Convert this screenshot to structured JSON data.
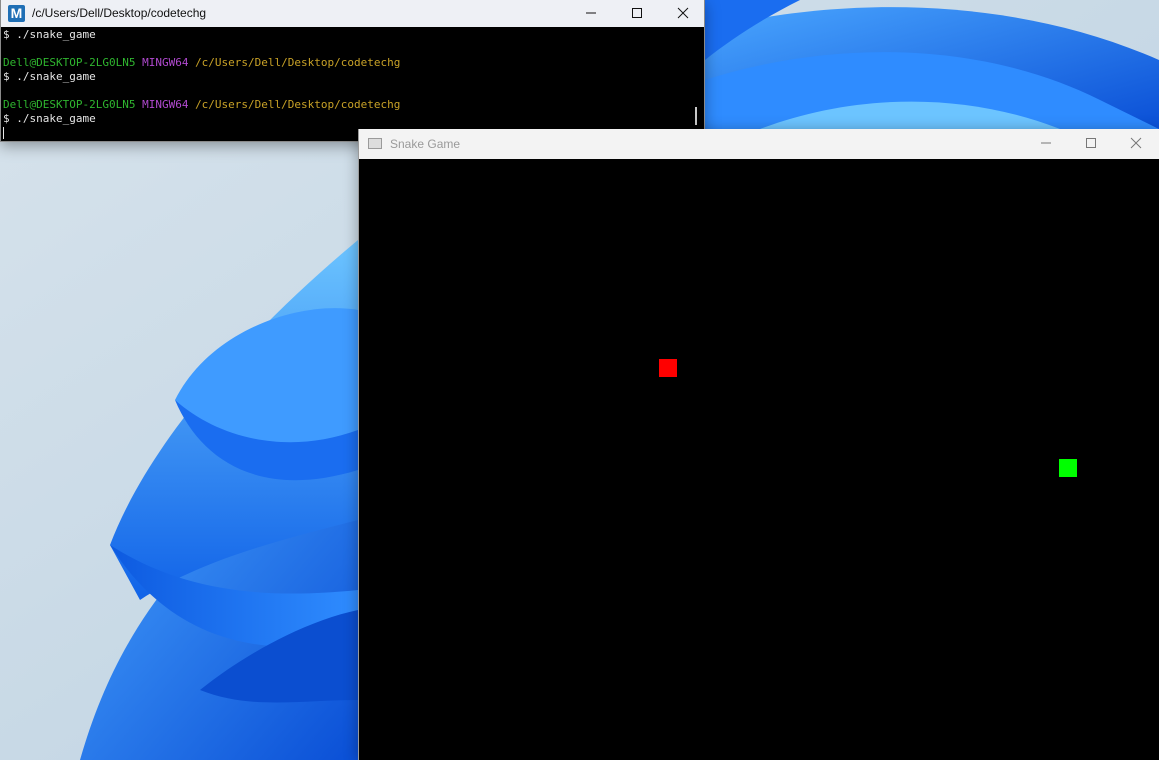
{
  "terminal": {
    "title": "/c/Users/Dell/Desktop/codetechg",
    "app_icon_letter": "M",
    "lines": [
      {
        "parts": [
          {
            "text": "$ ./snake_game",
            "color": "default"
          }
        ]
      },
      {
        "parts": []
      },
      {
        "parts": [
          {
            "text": "Dell@DESKTOP-2LG0LN5",
            "color": "user"
          },
          {
            "text": " ",
            "color": "default"
          },
          {
            "text": "MINGW64",
            "color": "sys"
          },
          {
            "text": " ",
            "color": "default"
          },
          {
            "text": "/c/Users/Dell/Desktop/codetechg",
            "color": "path"
          }
        ]
      },
      {
        "parts": [
          {
            "text": "$ ./snake_game",
            "color": "default"
          }
        ]
      },
      {
        "parts": []
      },
      {
        "parts": [
          {
            "text": "Dell@DESKTOP-2LG0LN5",
            "color": "user"
          },
          {
            "text": " ",
            "color": "default"
          },
          {
            "text": "MINGW64",
            "color": "sys"
          },
          {
            "text": " ",
            "color": "default"
          },
          {
            "text": "/c/Users/Dell/Desktop/codetechg",
            "color": "path"
          }
        ]
      },
      {
        "parts": [
          {
            "text": "$ ./snake_game",
            "color": "default"
          }
        ]
      }
    ]
  },
  "game_window": {
    "title": "Snake Game",
    "background_color": "#000000",
    "food": {
      "color": "#ff0000"
    },
    "snake": {
      "color": "#00ff00",
      "segments": 1
    }
  },
  "colors": {
    "prompt_user": "#2fb52f",
    "prompt_system": "#b24ad1",
    "prompt_path": "#c9a227",
    "wallpaper_accent": "#1a73ff"
  }
}
